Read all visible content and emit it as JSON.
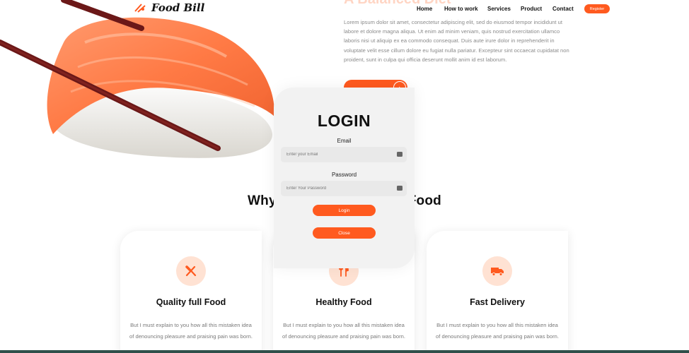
{
  "brand": {
    "name": "Food Bill",
    "accent": "#ff5a1f",
    "accent_light": "#ffe2d3"
  },
  "nav": {
    "items": [
      "Home",
      "How to work",
      "Services",
      "Product",
      "Contact"
    ],
    "register_label": "Register"
  },
  "hero": {
    "heading": "A Balanced Diet",
    "paragraph": "Lorem ipsum dolor sit amet, consectetur adipiscing elit, sed do eiusmod tempor incididunt ut labore et dolore magna aliqua. Ut enim ad minim veniam, quis nostrud exercitation ullamco laboris nisi ut aliquip ex ea commodo consequat. Duis aute irure dolor in reprehenderit in voluptate velit esse cillum dolore eu fugiat nulla pariatur. Excepteur sint occaecat cupidatat non proident, sunt in culpa qui officia deserunt mollit anim id est laborum."
  },
  "why": {
    "heading_left": "Why",
    "heading_right": "Food"
  },
  "features": [
    {
      "title": "Quality full Food",
      "icon": "fork-knife-icon",
      "text": "But I must explain to you how all this mistaken idea of denouncing pleasure and praising pain was born."
    },
    {
      "title": "Healthy Food",
      "icon": "fork-spoon-icon",
      "text": "But I must explain to you how all this mistaken idea of denouncing pleasure and praising pain was born."
    },
    {
      "title": "Fast Delivery",
      "icon": "truck-icon",
      "text": "But I must explain to you how all this mistaken idea of denouncing pleasure and praising pain was born."
    }
  ],
  "login": {
    "title": "LOGIN",
    "email_label": "Email",
    "email_placeholder": "Enter your Email",
    "password_label": "Password",
    "password_placeholder": "Enter Your Password",
    "login_button": "Login",
    "close_button": "Close"
  }
}
